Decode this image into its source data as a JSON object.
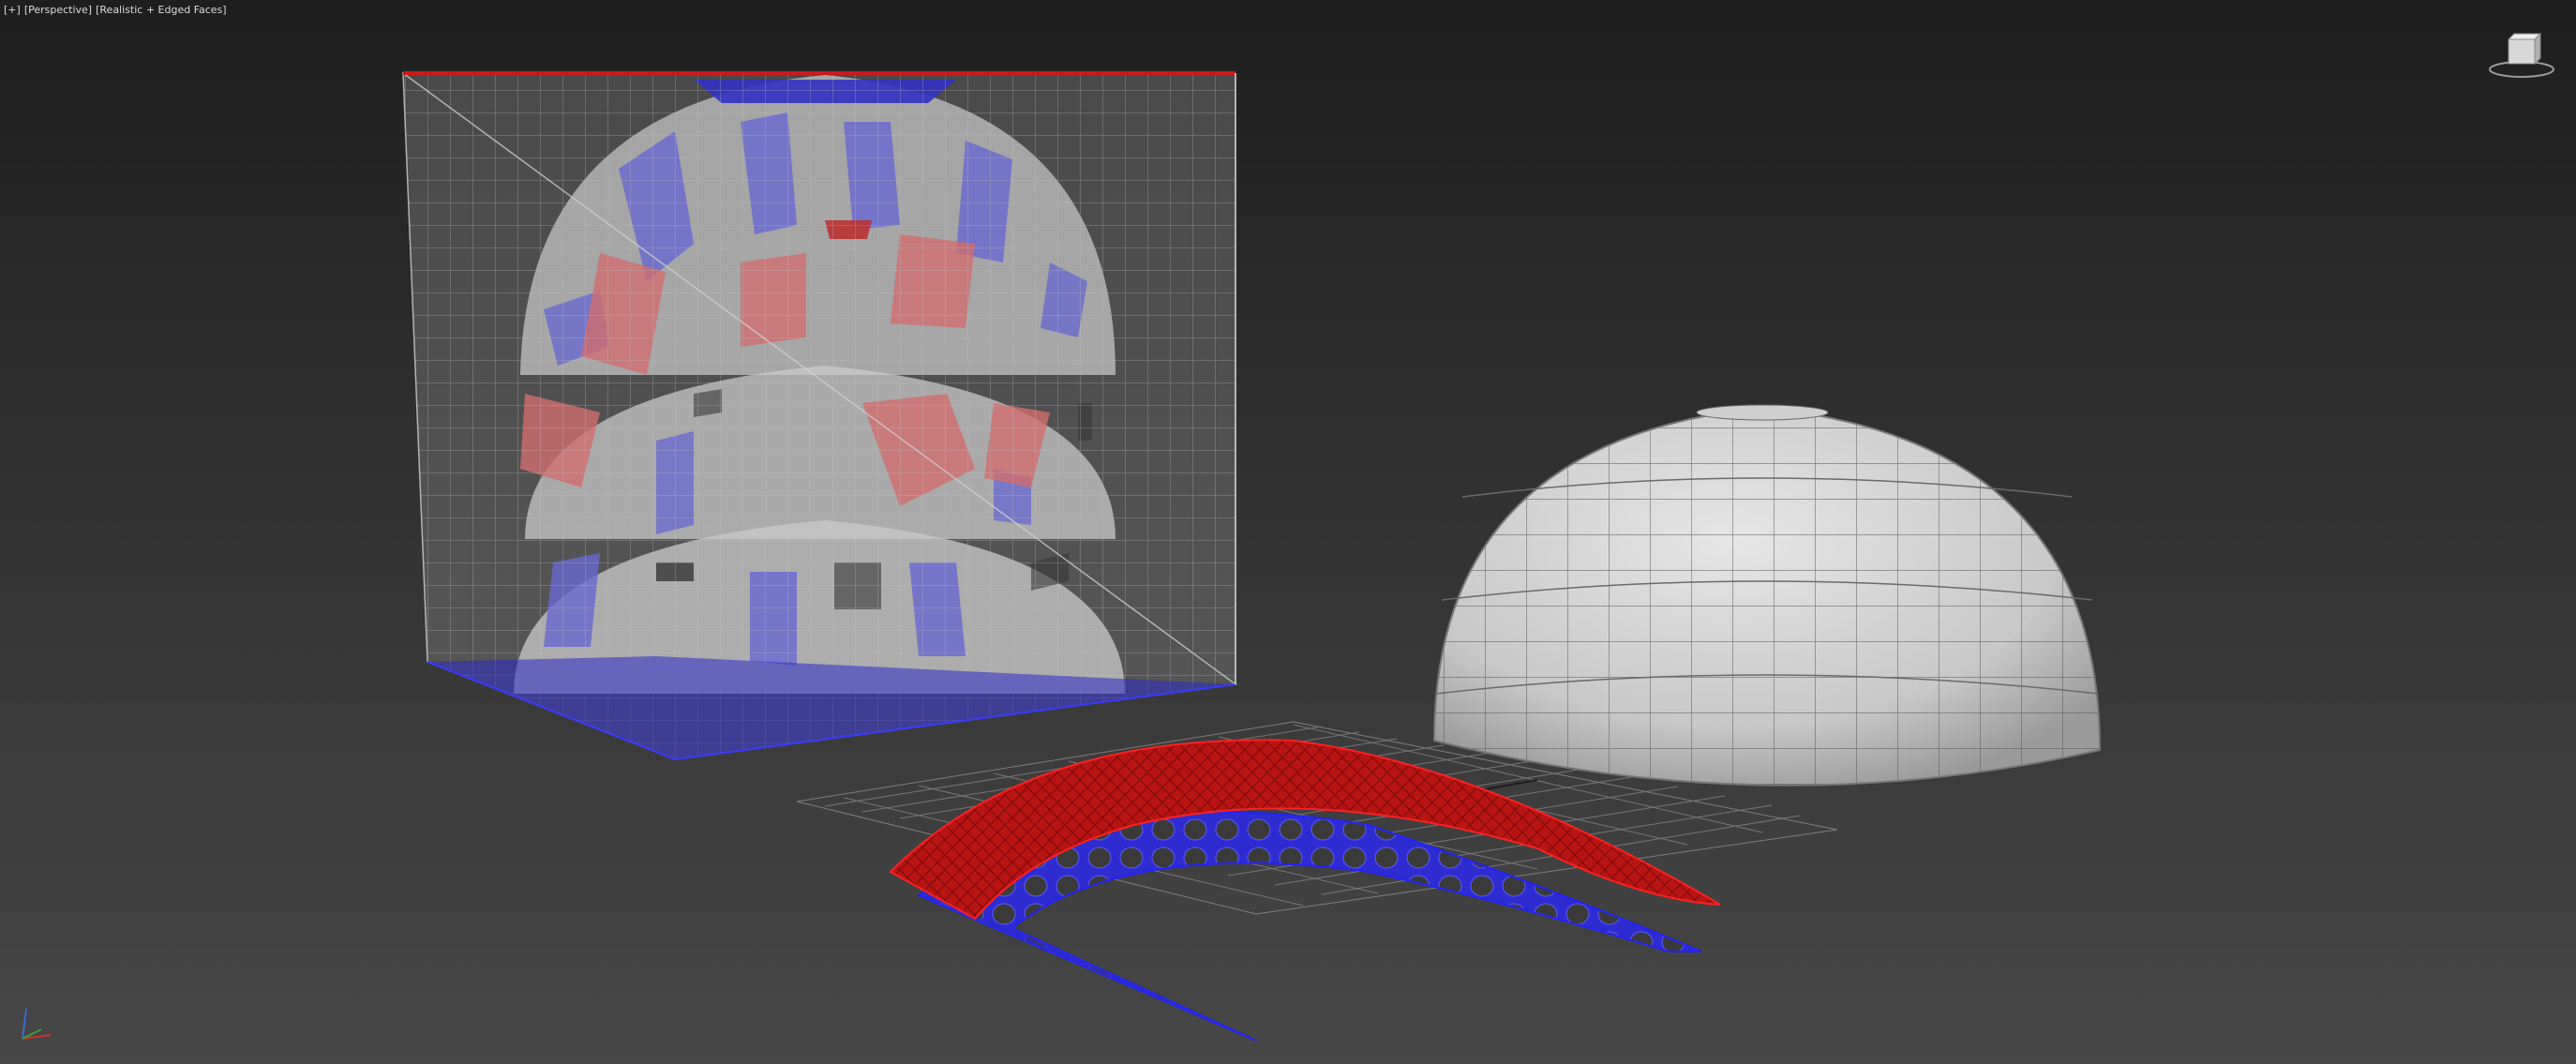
{
  "viewport": {
    "label_plus": "[+]",
    "label_view": "[Perspective]",
    "label_shading": "[Realistic + Edged Faces]"
  },
  "scene": {
    "objects": [
      "transparent-box",
      "dome-stack",
      "solid-dome",
      "curved-panel-red",
      "curved-panel-blue",
      "ground-grid"
    ]
  },
  "icons": {
    "viewcube": "viewcube-icon",
    "axis": "axis-tripod-icon"
  },
  "colors": {
    "background_top": "#1e1e1e",
    "background_bottom": "#474747",
    "selection_red": "#c81818",
    "selection_blue": "#2a2ac8",
    "mesh_gray": "#d0d0d0"
  }
}
